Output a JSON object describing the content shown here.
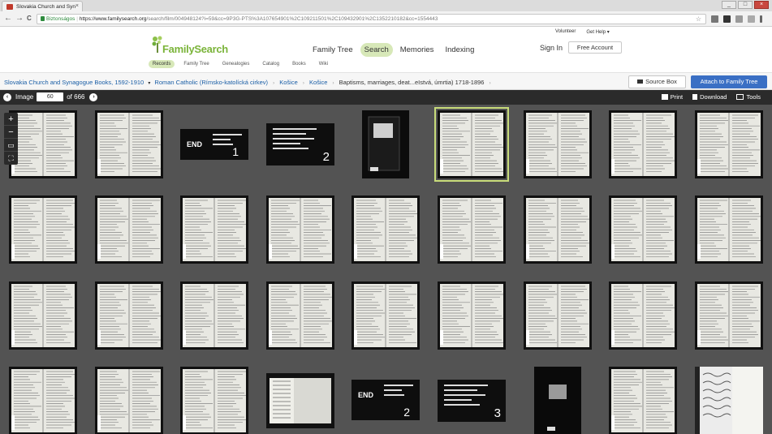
{
  "browser": {
    "tab_title": "Slovakia Church and Syn",
    "tab_close": "×",
    "url_secure_label": "Biztonságos",
    "url_domain": "https://www.familysearch.org",
    "url_path": "/search/film/004948124?i=59&cc=9P3G-PTS%3A107654901%2C109211501%2C109432901%2C1352210182&cc=1554443",
    "star": "☆",
    "back": "←",
    "forward": "→",
    "reload": "C"
  },
  "header": {
    "logo_text": "FamilySearch",
    "nav": [
      "Family Tree",
      "Search",
      "Memories",
      "Indexing"
    ],
    "nav_active": "Search",
    "volunteer": "Volunteer",
    "get_help": "Get Help ▾",
    "sign_in": "Sign In",
    "free_account": "Free Account",
    "sub_nav": [
      "Records",
      "Family Tree",
      "Genealogies",
      "Catalog",
      "Books",
      "Wiki"
    ],
    "sub_nav_active": "Records"
  },
  "breadcrumb": {
    "collection": "Slovakia Church and Synagogue Books, 1592-1910",
    "religion": "Roman Catholic (Rímsko-katolícká cirkev)",
    "place1": "Košice",
    "place2": "Košice",
    "current": "Baptisms, marriages, deat...eIstvá, úmrtia) 1718-1896",
    "dropdown_glyph": "▾",
    "separator": "›"
  },
  "actions": {
    "source_box": "Source Box",
    "attach": "Attach to Family Tree"
  },
  "viewer": {
    "image_label": "Image",
    "current_image": "60",
    "total_label": "of 666",
    "prev": "‹",
    "next": "›",
    "print": "Print",
    "download": "Download",
    "tools": "Tools",
    "zoom_in": "+",
    "zoom_out": "−",
    "fit_icon": "▭",
    "fullscreen_icon": "⛶"
  },
  "thumbnails": {
    "end_label": "END",
    "end_card_numbers": [
      "1",
      "2"
    ],
    "target_card_numbers": [
      "2",
      "3"
    ],
    "selected_index": 5
  }
}
